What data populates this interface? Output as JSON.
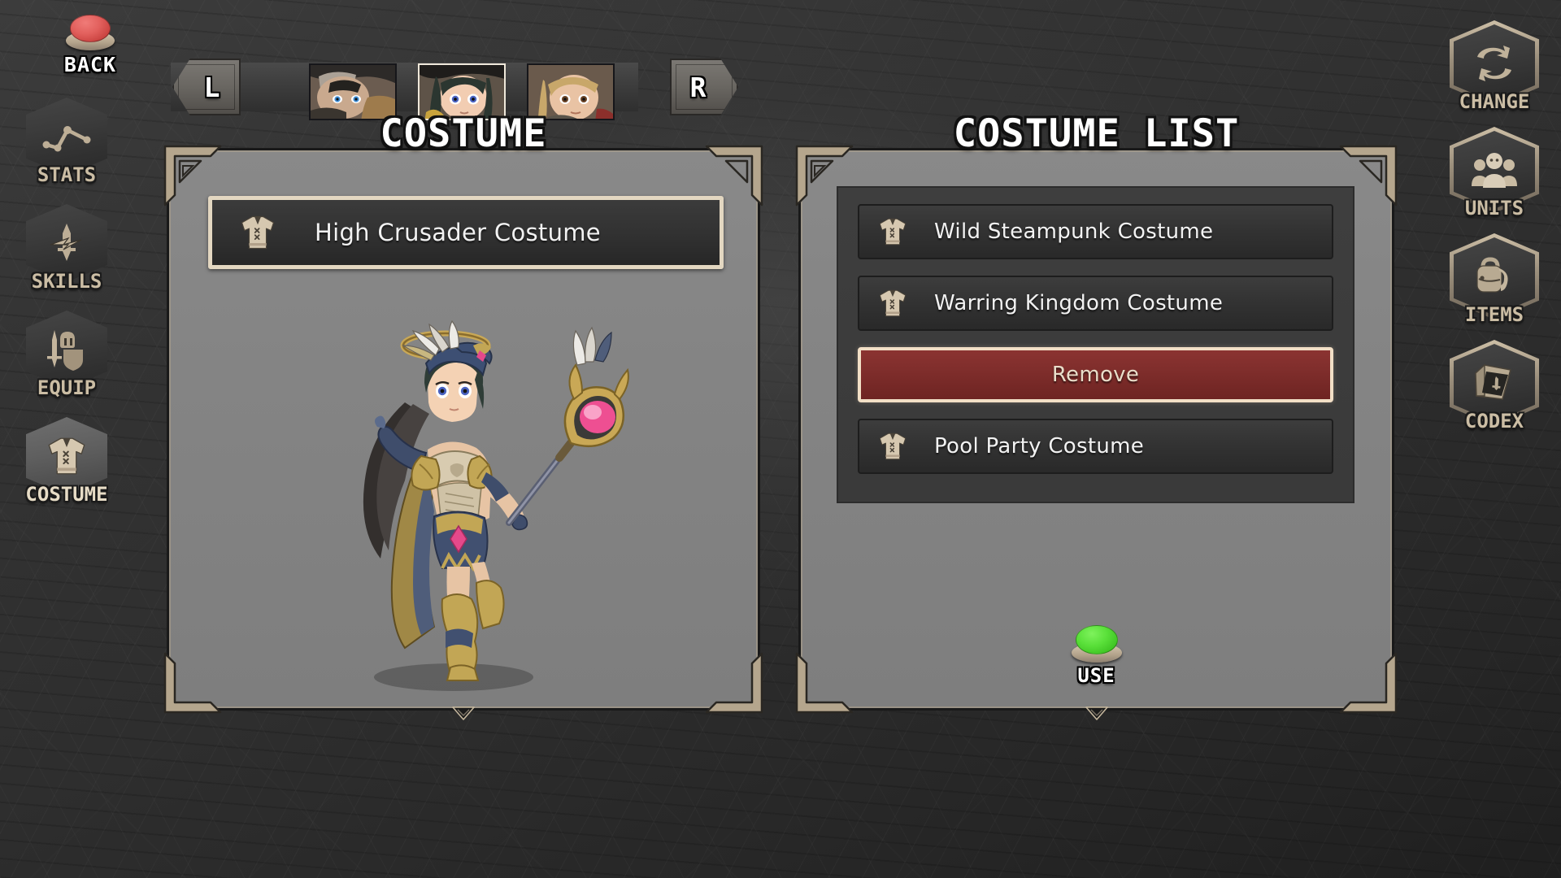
{
  "back_button": {
    "label": "BACK",
    "icon": "red-round-button-icon",
    "color": "#e2605d"
  },
  "left_nav": {
    "items": [
      {
        "label": "STATS",
        "icon": "line-chart-icon",
        "active": false
      },
      {
        "label": "SKILLS",
        "icon": "sword-lightning-icon",
        "active": false
      },
      {
        "label": "EQUIP",
        "icon": "sword-shield-helmet-icon",
        "active": false
      },
      {
        "label": "COSTUME",
        "icon": "costume-shirt-icon",
        "active": true
      }
    ]
  },
  "right_nav": {
    "items": [
      {
        "label": "CHANGE",
        "icon": "refresh-arrows-icon",
        "active": false
      },
      {
        "label": "UNITS",
        "icon": "three-people-icon",
        "active": false
      },
      {
        "label": "ITEMS",
        "icon": "backpack-icon",
        "active": false
      },
      {
        "label": "CODEX",
        "icon": "book-sword-icon",
        "active": false
      }
    ]
  },
  "character_bar": {
    "prev_label": "L",
    "next_label": "R",
    "portraits": [
      {
        "name": "portrait-1",
        "selected": false
      },
      {
        "name": "portrait-2",
        "selected": true
      },
      {
        "name": "portrait-3",
        "selected": false
      }
    ]
  },
  "costume_panel": {
    "title": "COSTUME",
    "equipped": {
      "name": "High Crusader Costume",
      "icon": "costume-shirt-icon"
    },
    "character_art": "high-crusader-female-mage-with-staff-and-halo"
  },
  "costume_list_panel": {
    "title": "COSTUME LIST",
    "items": [
      {
        "name": "Wild Steampunk Costume",
        "icon": "costume-shirt-icon",
        "kind": "costume"
      },
      {
        "name": "Warring Kingdom Costume",
        "icon": "costume-shirt-icon",
        "kind": "costume"
      },
      {
        "name": "Remove",
        "icon": "none",
        "kind": "action-danger"
      },
      {
        "name": "Pool Party Costume",
        "icon": "costume-shirt-icon",
        "kind": "costume"
      }
    ],
    "use_button": {
      "label": "USE",
      "icon": "green-round-button-icon",
      "color": "#5ae03a"
    }
  },
  "colors": {
    "accent_cream": "#e3d7c1",
    "danger_red": "#7e2d2b",
    "panel_gray": "#848484",
    "background_dark": "#2e2e2e",
    "nav_label": "#cbbda4"
  }
}
